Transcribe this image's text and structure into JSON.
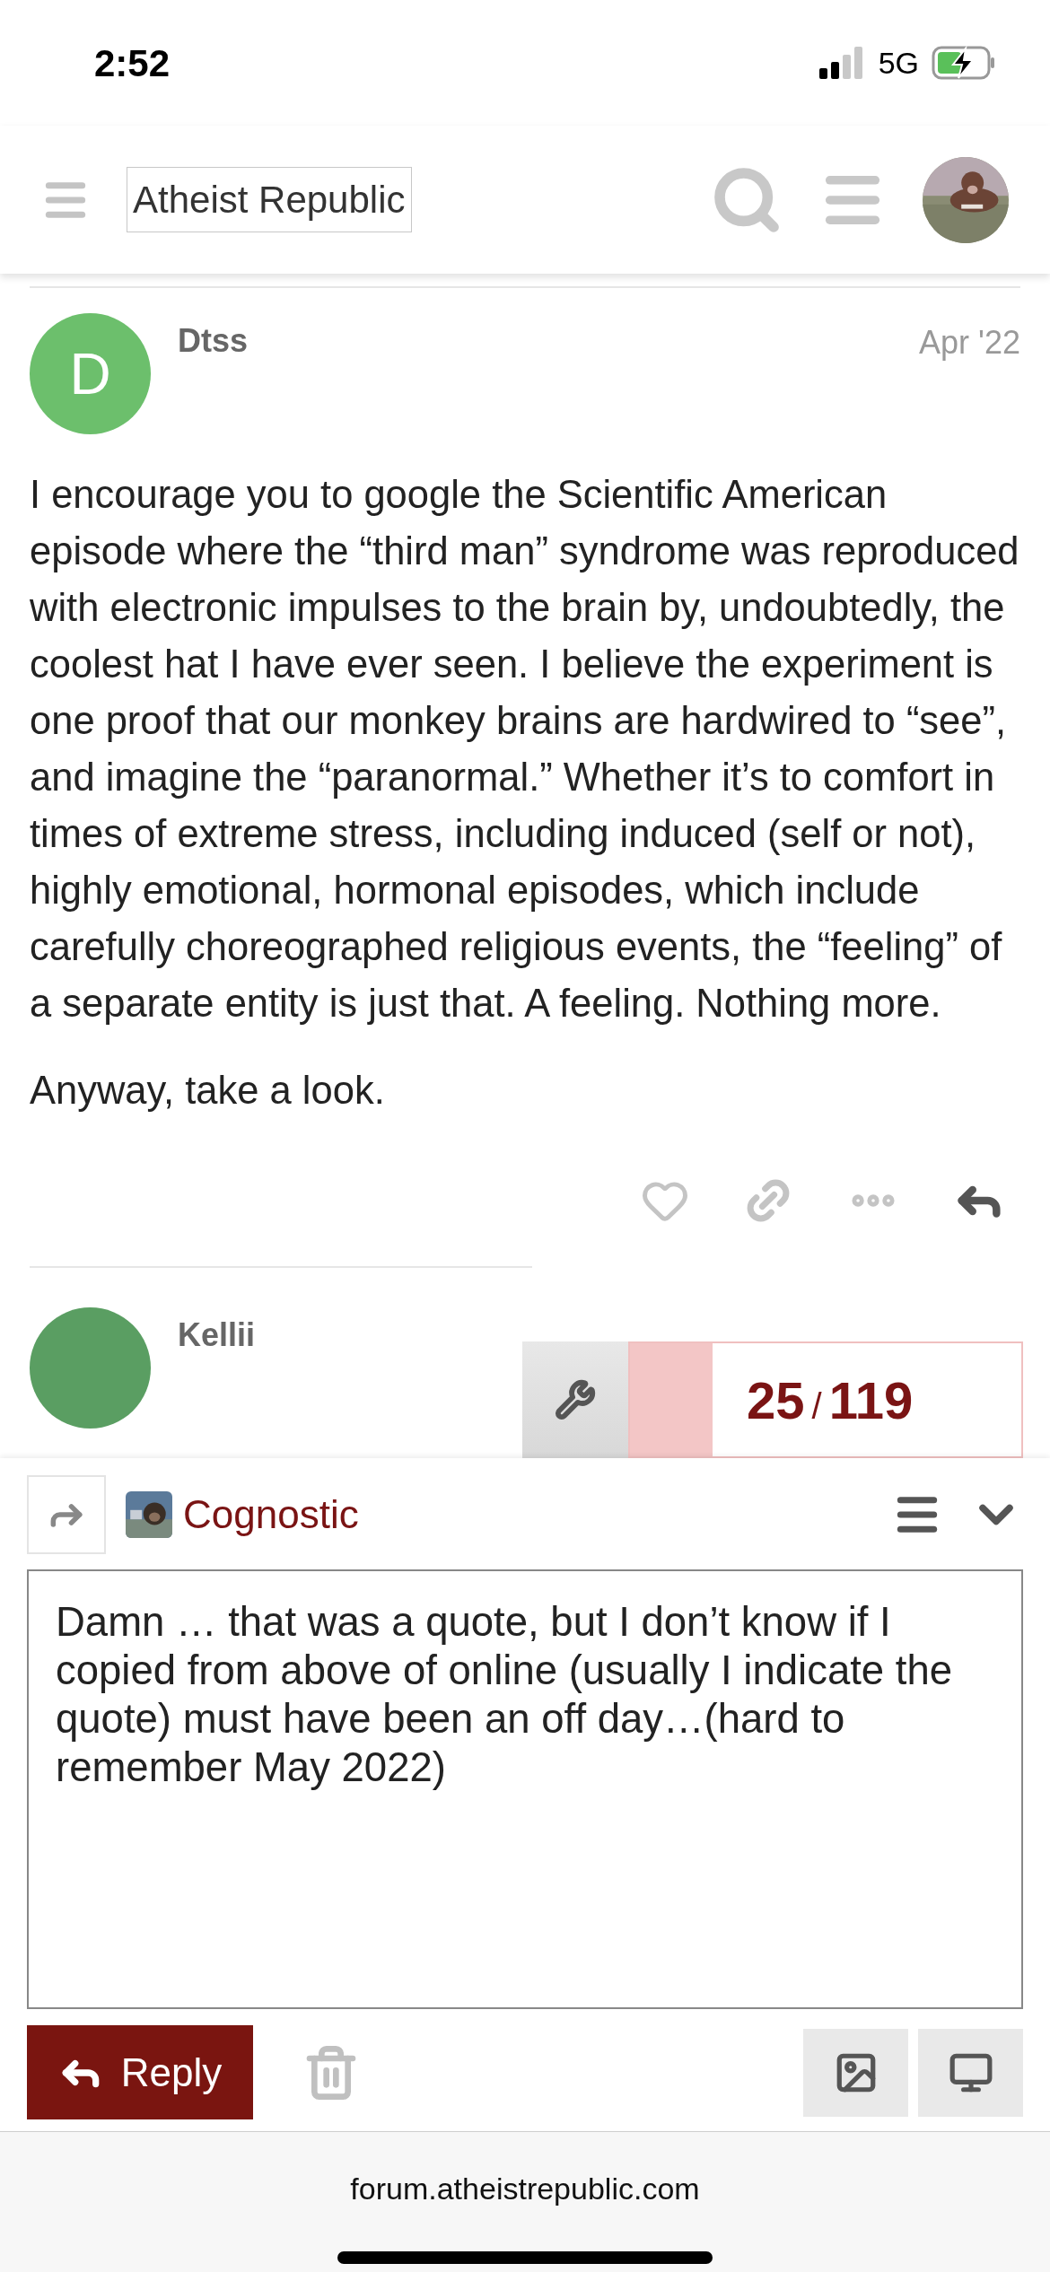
{
  "status_bar": {
    "time": "2:52",
    "network": "5G"
  },
  "header": {
    "site_title": "Atheist Republic"
  },
  "post": {
    "author": "Dtss",
    "avatar_letter": "D",
    "color": "#6cbf6c",
    "date": "Apr '22",
    "paragraphs": [
      "I encourage you to google the Scientific American episode where the “third man” syndrome was reproduced with electronic impulses to the brain by, undoubtedly, the coolest hat I have ever seen. I believe the experiment is one proof that our monkey brains are hardwired to “see”, and imagine the “paranormal.” Whether it’s to comfort in times of extreme stress, including induced (self or not), highly emotional, hormonal episodes, which include carefully choreographed religious events, the “feeling” of a separate entity is just that. A feeling. Nothing more.",
      "Anyway, take a look."
    ]
  },
  "next_post": {
    "author": "Kellii",
    "color": "#5a9e62"
  },
  "progress": {
    "current": "25",
    "separator": "/",
    "total": "119",
    "level": 0.21
  },
  "composer": {
    "replying_as": "Cognostic",
    "text": "Damn … that was a quote, but I don’t know if I copied from above of online (usually I indicate the quote) must have been an off day…(hard to remember May 2022)",
    "submit_label": "Reply"
  },
  "browser": {
    "url": "forum.atheistrepublic.com"
  }
}
